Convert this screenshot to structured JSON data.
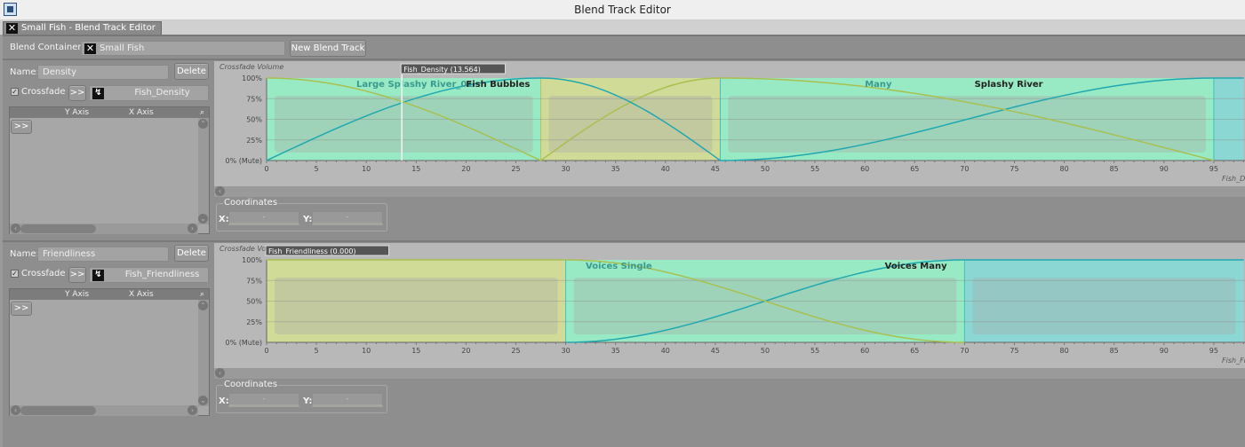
{
  "window": {
    "title": "Blend Track Editor"
  },
  "tab": {
    "label": "Small Fish - Blend Track Editor"
  },
  "header": {
    "container_label": "Blend Container:",
    "container_value": "Small Fish",
    "new_track_button": "New Blend Track"
  },
  "common": {
    "name_label": "Name:",
    "delete_button": "Delete",
    "crossfade_label": "Crossfade",
    "expand_button": ">>",
    "y_axis_header": "Y Axis",
    "x_axis_header": "X Axis",
    "coordinates_title": "Coordinates",
    "x_label": "X:",
    "y_label": "Y:",
    "x_value": "-",
    "y_value": "-",
    "y_axis_title": "Crossfade Volume"
  },
  "colors": {
    "green_region": "#96ecc4",
    "yellow_region": "#d2dc96",
    "teal_region": "#88d8d4",
    "teal_curve": "#20a8b0",
    "yellow_curve": "#a8c050"
  },
  "tracks": [
    {
      "name": "Density",
      "crossfade": true,
      "parameter": "Fish_Density",
      "cursor_label": "Fish_Density (13.564)",
      "x_axis_label": "Fish_Density",
      "labels": [
        {
          "text": "Large Splashy River_01",
          "x": 9,
          "style": "teal"
        },
        {
          "text": "Fish Bubbles",
          "x": 20,
          "style": "dark"
        },
        {
          "text": "Many",
          "x": 60,
          "style": "teal"
        },
        {
          "text": "Splashy River",
          "x": 71,
          "style": "dark"
        }
      ]
    },
    {
      "name": "Friendliness",
      "crossfade": true,
      "parameter": "Fish_Friendliness",
      "cursor_label": "Fish_Friendliness (0.000)",
      "x_axis_label": "Fish_Friendliness",
      "labels": [
        {
          "text": "Voices Single",
          "x": 32,
          "style": "teal"
        },
        {
          "text": "Voices Many",
          "x": 62,
          "style": "dark"
        }
      ]
    }
  ],
  "chart_data": [
    {
      "type": "area",
      "title": "",
      "ylabel": "Crossfade Volume",
      "xlabel": "Fish_Density",
      "xlim": [
        0,
        98
      ],
      "ylim": [
        0,
        100
      ],
      "yticks": [
        "0% (Mute)",
        "25%",
        "50%",
        "75%",
        "100%"
      ],
      "xticks": [
        0,
        5,
        10,
        15,
        20,
        25,
        30,
        35,
        40,
        45,
        50,
        55,
        60,
        65,
        70,
        75,
        80,
        85,
        90,
        95
      ],
      "cursor": 13.564,
      "regions": [
        {
          "from": 0,
          "to": 27.5,
          "color": "green"
        },
        {
          "from": 27.5,
          "to": 45.5,
          "color": "yellow"
        },
        {
          "from": 45.5,
          "to": 95,
          "color": "green"
        },
        {
          "from": 95,
          "to": 98,
          "color": "teal"
        }
      ],
      "curves": [
        {
          "from": 0,
          "to": 27.5,
          "dir": "up",
          "shape": "sine",
          "color": "teal"
        },
        {
          "from": 0,
          "to": 27.5,
          "dir": "down",
          "shape": "cos",
          "color": "yellow"
        },
        {
          "from": 27.5,
          "to": 45.5,
          "dir": "up",
          "shape": "sine",
          "color": "yellow"
        },
        {
          "from": 27.5,
          "to": 45.5,
          "dir": "down",
          "shape": "cos",
          "color": "teal"
        },
        {
          "from": 45.5,
          "to": 95,
          "dir": "up",
          "shape": "s",
          "color": "teal"
        },
        {
          "from": 45.5,
          "to": 95,
          "dir": "down",
          "shape": "cos",
          "color": "yellow"
        },
        {
          "from": 95,
          "to": 98,
          "dir": "flat",
          "shape": "flat",
          "color": "teal"
        }
      ]
    },
    {
      "type": "area",
      "title": "",
      "ylabel": "Crossfade Volume",
      "xlabel": "Fish_Friendliness",
      "xlim": [
        0,
        98
      ],
      "ylim": [
        0,
        100
      ],
      "yticks": [
        "0% (Mute)",
        "25%",
        "50%",
        "75%",
        "100%"
      ],
      "xticks": [
        0,
        5,
        10,
        15,
        20,
        25,
        30,
        35,
        40,
        45,
        50,
        55,
        60,
        65,
        70,
        75,
        80,
        85,
        90,
        95
      ],
      "cursor": 0,
      "regions": [
        {
          "from": 0,
          "to": 30,
          "color": "yellow"
        },
        {
          "from": 30,
          "to": 70,
          "color": "green"
        },
        {
          "from": 70,
          "to": 98,
          "color": "teal"
        }
      ],
      "curves": [
        {
          "from": 0,
          "to": 30,
          "dir": "flat",
          "shape": "flat",
          "color": "yellow"
        },
        {
          "from": 30,
          "to": 70,
          "dir": "up",
          "shape": "s",
          "color": "teal"
        },
        {
          "from": 30,
          "to": 70,
          "dir": "down",
          "shape": "s",
          "color": "yellow"
        },
        {
          "from": 70,
          "to": 98,
          "dir": "flat",
          "shape": "flat",
          "color": "teal"
        }
      ]
    }
  ]
}
